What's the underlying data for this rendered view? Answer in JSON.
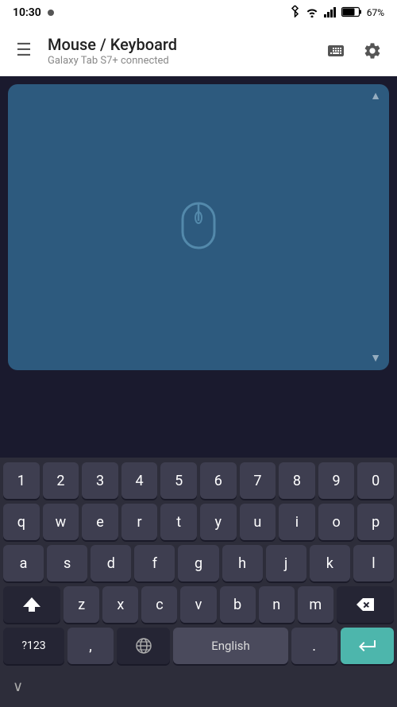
{
  "statusBar": {
    "time": "10:30",
    "batteryPercent": "67%"
  },
  "appBar": {
    "title": "Mouse / Keyboard",
    "subtitle": "Galaxy Tab S7+ connected",
    "menuIcon": "☰",
    "keyboardIconLabel": "keyboard-icon",
    "settingsIconLabel": "settings-icon"
  },
  "trackpad": {
    "mouseIconLabel": "mouse-cursor-icon",
    "scrollUpLabel": "▲",
    "scrollDownLabel": "▼"
  },
  "keyboard": {
    "numberRow": [
      "1",
      "2",
      "3",
      "4",
      "5",
      "6",
      "7",
      "8",
      "9",
      "0"
    ],
    "row1": [
      "q",
      "w",
      "e",
      "r",
      "t",
      "y",
      "u",
      "i",
      "o",
      "p"
    ],
    "row2": [
      "a",
      "s",
      "d",
      "f",
      "g",
      "h",
      "j",
      "k",
      "l"
    ],
    "row3": [
      "z",
      "x",
      "c",
      "v",
      "b",
      "n",
      "m"
    ],
    "symbolKeyLabel": "?123",
    "commaLabel": ",",
    "spaceLabel": "English",
    "dotLabel": ".",
    "enterIconLabel": "↵",
    "shiftIconLabel": "⇧",
    "backspaceIconLabel": "⌫",
    "globeIconLabel": "🌐",
    "chevronDownLabel": "∨"
  }
}
